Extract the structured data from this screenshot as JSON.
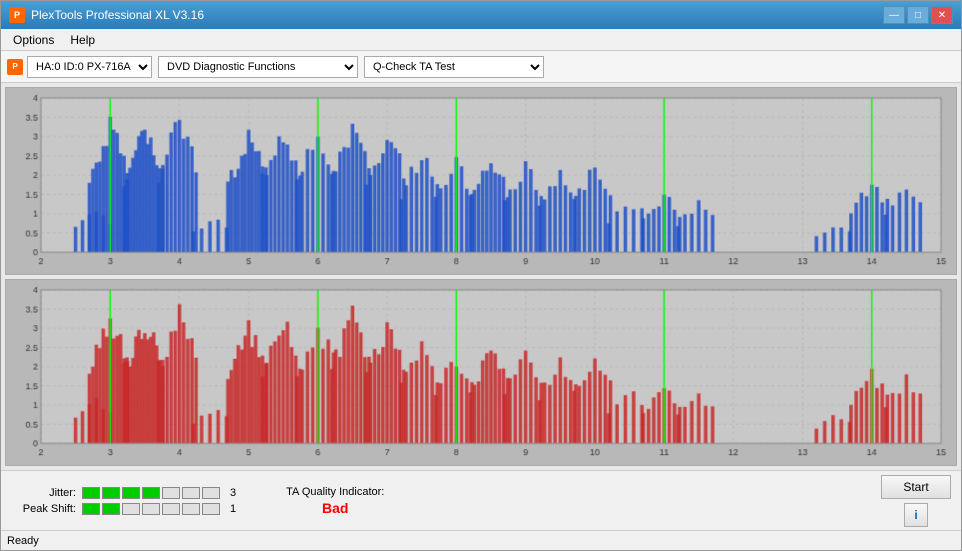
{
  "window": {
    "title": "PlexTools Professional XL V3.16",
    "icon": "P"
  },
  "titlebar": {
    "minimize": "—",
    "maximize": "□",
    "close": "✕"
  },
  "menu": {
    "items": [
      "Options",
      "Help"
    ]
  },
  "toolbar": {
    "drive": "HA:0 ID:0  PX-716A",
    "function": "DVD Diagnostic Functions",
    "test": "Q-Check TA Test"
  },
  "charts": {
    "top": {
      "label": "top-chart",
      "yMax": 4,
      "xMin": 2,
      "xMax": 15,
      "yTicks": [
        0,
        0.5,
        1,
        1.5,
        2,
        2.5,
        3,
        3.5,
        4
      ],
      "xTicks": [
        2,
        3,
        4,
        5,
        6,
        7,
        8,
        9,
        10,
        11,
        12,
        13,
        14,
        15
      ],
      "color": "blue"
    },
    "bottom": {
      "label": "bottom-chart",
      "yMax": 4,
      "xMin": 2,
      "xMax": 15,
      "yTicks": [
        0,
        0.5,
        1,
        1.5,
        2,
        2.5,
        3,
        3.5,
        4
      ],
      "xTicks": [
        2,
        3,
        4,
        5,
        6,
        7,
        8,
        9,
        10,
        11,
        12,
        13,
        14,
        15
      ],
      "color": "red"
    }
  },
  "metrics": {
    "jitter": {
      "label": "Jitter:",
      "greenSegments": 4,
      "totalSegments": 7,
      "value": "3"
    },
    "peakShift": {
      "label": "Peak Shift:",
      "greenSegments": 2,
      "totalSegments": 7,
      "value": "1"
    },
    "taQuality": {
      "label": "TA Quality Indicator:",
      "value": "Bad",
      "color": "red"
    }
  },
  "buttons": {
    "start": "Start",
    "info": "i"
  },
  "statusBar": {
    "text": "Ready"
  }
}
